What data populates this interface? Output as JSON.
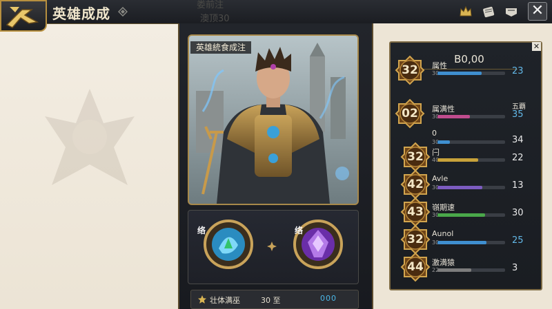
{
  "header": {
    "title": "英雄成成",
    "faded_text_1": "娄前注",
    "faded_text_2": "澳顶30"
  },
  "hero": {
    "caption": "英雄統食成注"
  },
  "skills": [
    {
      "tag": "络",
      "color": "#3aa8d8"
    },
    {
      "tag": "络",
      "color": "#8a3ec8"
    }
  ],
  "footer": {
    "label": "壮体满巫",
    "value": "30 至",
    "dots": "000"
  },
  "stats": {
    "header": "B0,00",
    "rows": [
      {
        "badge": "32",
        "name": "属性",
        "sub": "30",
        "value": "23",
        "value_blue": true,
        "fill": 0.65,
        "color": "#3f8fd0",
        "extra": ""
      },
      {
        "badge": "02",
        "name": "属满性",
        "sub": "30",
        "value": "35",
        "value_blue": true,
        "fill": 0.48,
        "color": "#c04c8e",
        "extra": "五覇"
      },
      {
        "badge": "",
        "name": "0",
        "sub": "30",
        "value": "34",
        "value_blue": false,
        "fill": 0.18,
        "color": "#3f8fd0",
        "extra": ""
      },
      {
        "badge": "32",
        "name": "闩",
        "sub": "40",
        "value": "22",
        "value_blue": false,
        "fill": 0.6,
        "color": "#c8a23a",
        "extra": ""
      },
      {
        "badge": "42",
        "name": "Avle",
        "sub": "30",
        "value": "13",
        "value_blue": false,
        "fill": 0.66,
        "color": "#7c5cc0",
        "extra": ""
      },
      {
        "badge": "43",
        "name": "嶺期速",
        "sub": "30",
        "value": "30",
        "value_blue": false,
        "fill": 0.7,
        "color": "#4aa84a",
        "extra": ""
      },
      {
        "badge": "32",
        "name": "Aunol",
        "sub": "30",
        "value": "25",
        "value_blue": true,
        "fill": 0.72,
        "color": "#3f8fd0",
        "extra": ""
      },
      {
        "badge": "44",
        "name": "激満猿",
        "sub": "22",
        "value": "3",
        "value_blue": false,
        "fill": 0.5,
        "color": "#7d7d7d",
        "extra": ""
      }
    ]
  },
  "colors": {
    "gold": "#b8903f",
    "panel": "#1f2329",
    "parchment": "#efe8da"
  },
  "icons": [
    "crown-icon",
    "scroll-icon",
    "banner-icon",
    "close-icon",
    "diamond-icon"
  ]
}
